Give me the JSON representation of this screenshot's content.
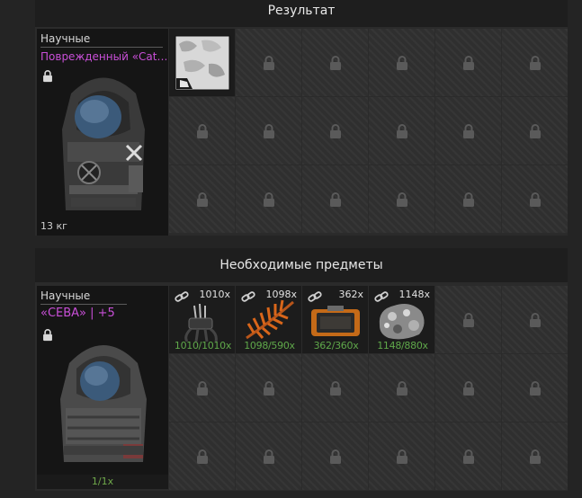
{
  "result_panel": {
    "title": "Результат",
    "item": {
      "category": "Научные",
      "name": "Поврежденный «Cat…",
      "weight": "13 кг"
    }
  },
  "required_panel": {
    "title": "Необходимые предметы",
    "item": {
      "category": "Научные",
      "name": "«СЕВА» | +5",
      "count": "1/1x"
    },
    "materials": [
      {
        "icon": "wire-bundle-icon",
        "qty": "1010x",
        "have": "1010/1010x"
      },
      {
        "icon": "fern-plant-icon",
        "qty": "1098x",
        "have": "1098/590x"
      },
      {
        "icon": "device-box-icon",
        "qty": "362x",
        "have": "362/360x"
      },
      {
        "icon": "ore-chunk-icon",
        "qty": "1148x",
        "have": "1148/880x"
      }
    ]
  },
  "colors": {
    "rarity_purple": "#c94fd8",
    "have_green": "#5fa84a",
    "fern_orange": "#d9661a"
  }
}
